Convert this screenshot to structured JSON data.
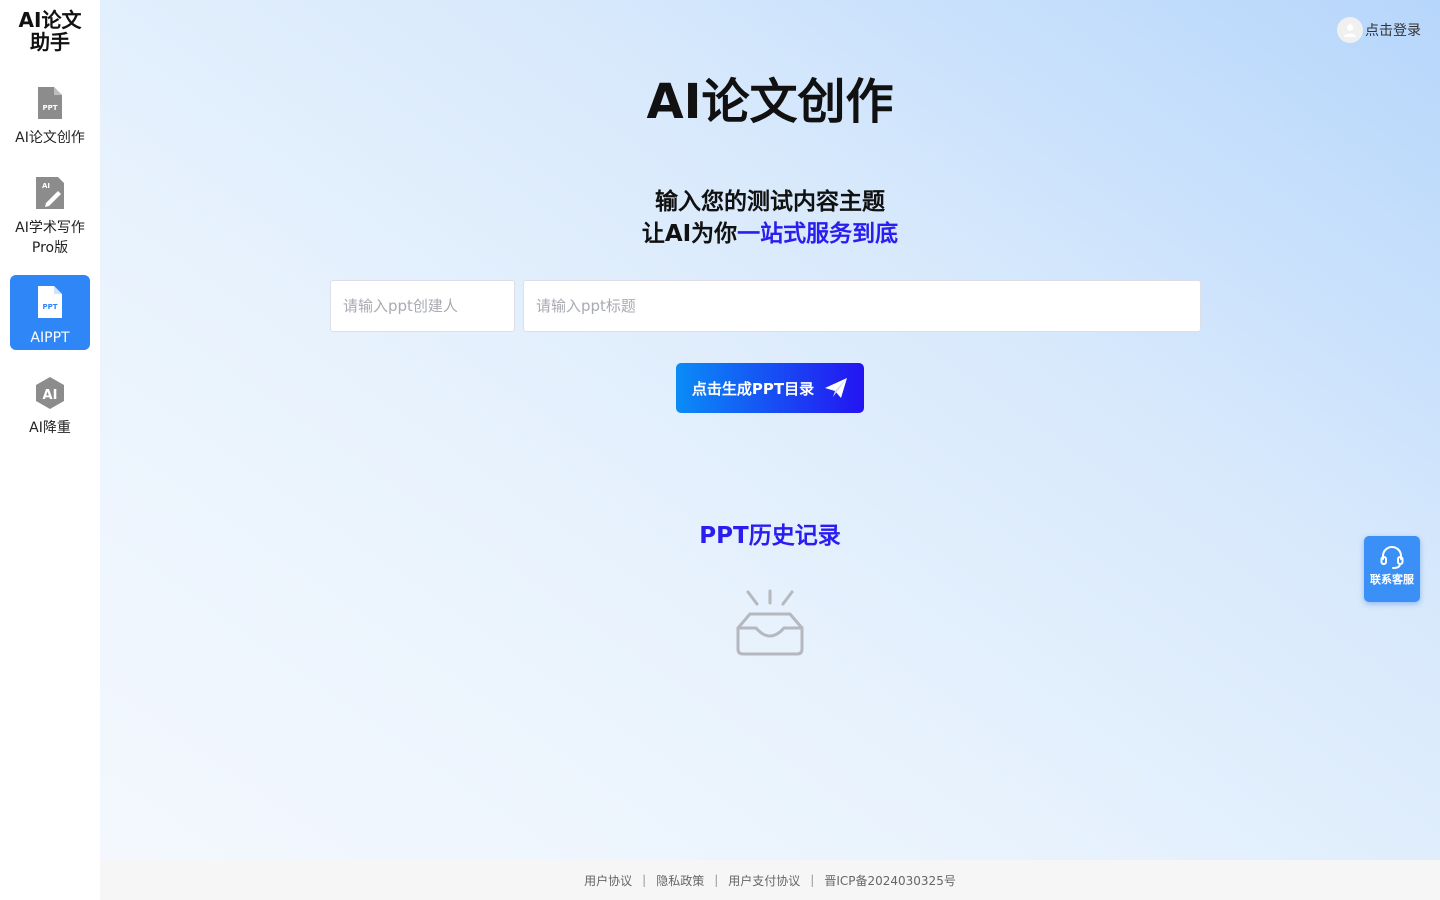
{
  "sidebar": {
    "logo_line1": "AI论文",
    "logo_line2": "助手",
    "items": [
      {
        "label": "AI论文创作",
        "icon": "ppt-file-icon"
      },
      {
        "label": "AI学术写作",
        "label2": "Pro版",
        "icon": "ai-edit-icon"
      },
      {
        "label": "AIPPT",
        "icon": "ppt-file-icon",
        "active": true
      },
      {
        "label": "AI降重",
        "icon": "ai-badge-icon"
      }
    ]
  },
  "header": {
    "login_label": "点击登录"
  },
  "main": {
    "title": "AI论文创作",
    "subtitle_line1": "输入您的测试内容主题",
    "subtitle_line2_prefix": "让AI为你",
    "subtitle_line2_highlight": "一站式服务到底",
    "creator_placeholder": "请输入ppt创建人",
    "title_placeholder": "请输入ppt标题",
    "generate_button": "点击生成PPT目录",
    "history_title": "PPT历史记录"
  },
  "support": {
    "label": "联系客服"
  },
  "footer": {
    "links": [
      "用户协议",
      "隐私政策",
      "用户支付协议",
      "晋ICP备2024030325号"
    ],
    "separator": "|"
  },
  "colors": {
    "accent": "#2f86f6",
    "highlight": "#2b1cf0",
    "button_start": "#0a8cf6",
    "button_end": "#2414f2"
  }
}
